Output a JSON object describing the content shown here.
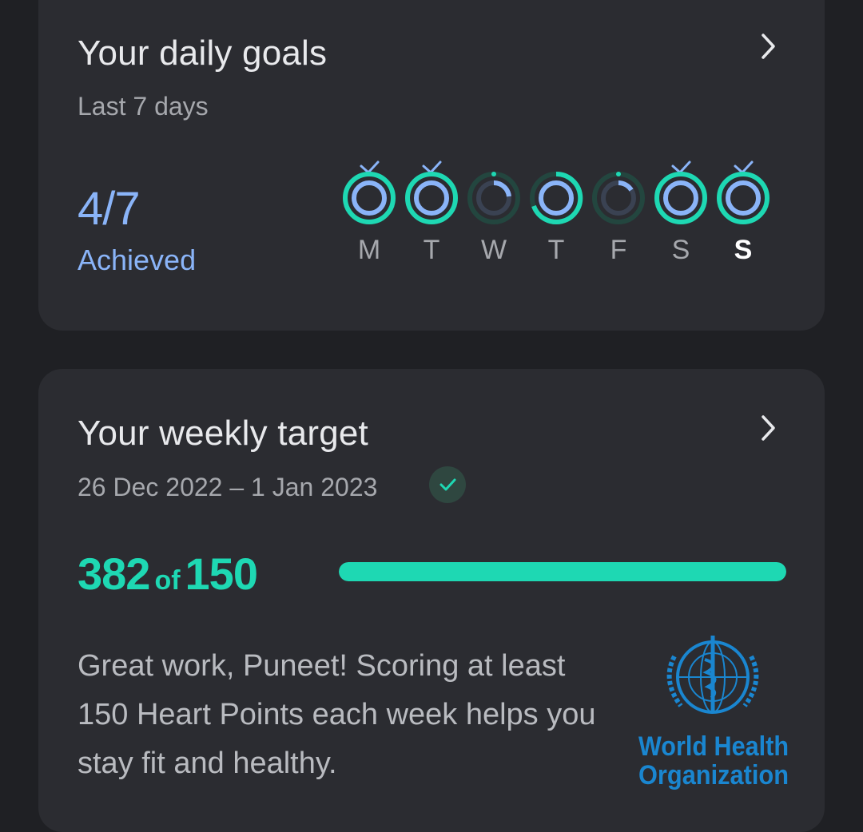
{
  "daily_goals": {
    "title": "Your daily goals",
    "subtitle": "Last 7 days",
    "count": "4/7",
    "status": "Achieved",
    "days": [
      {
        "label": "M",
        "achieved": true,
        "today": false
      },
      {
        "label": "T",
        "achieved": true,
        "today": false
      },
      {
        "label": "W",
        "achieved": false,
        "today": false
      },
      {
        "label": "T",
        "achieved": false,
        "today": false
      },
      {
        "label": "F",
        "achieved": false,
        "today": false
      },
      {
        "label": "S",
        "achieved": true,
        "today": false
      },
      {
        "label": "S",
        "achieved": true,
        "today": true
      }
    ]
  },
  "weekly_target": {
    "title": "Your weekly target",
    "date_range": "26 Dec 2022 – 1 Jan 2023",
    "current": "382",
    "of_label": "of",
    "target": "150",
    "progress_fraction": 1.0,
    "message": "Great work, Puneet! Scoring at least 150 Heart Points each week helps you stay fit and healthy.",
    "logo_text": "World Health Organization"
  },
  "colors": {
    "accent_blue": "#8ab4f8",
    "accent_green": "#1ed8b3",
    "card_bg": "#2b2c31",
    "page_bg": "#1f2024"
  },
  "icons": {
    "chevron": "chevron-right-icon",
    "check": "check-icon",
    "logo": "who-logo"
  }
}
